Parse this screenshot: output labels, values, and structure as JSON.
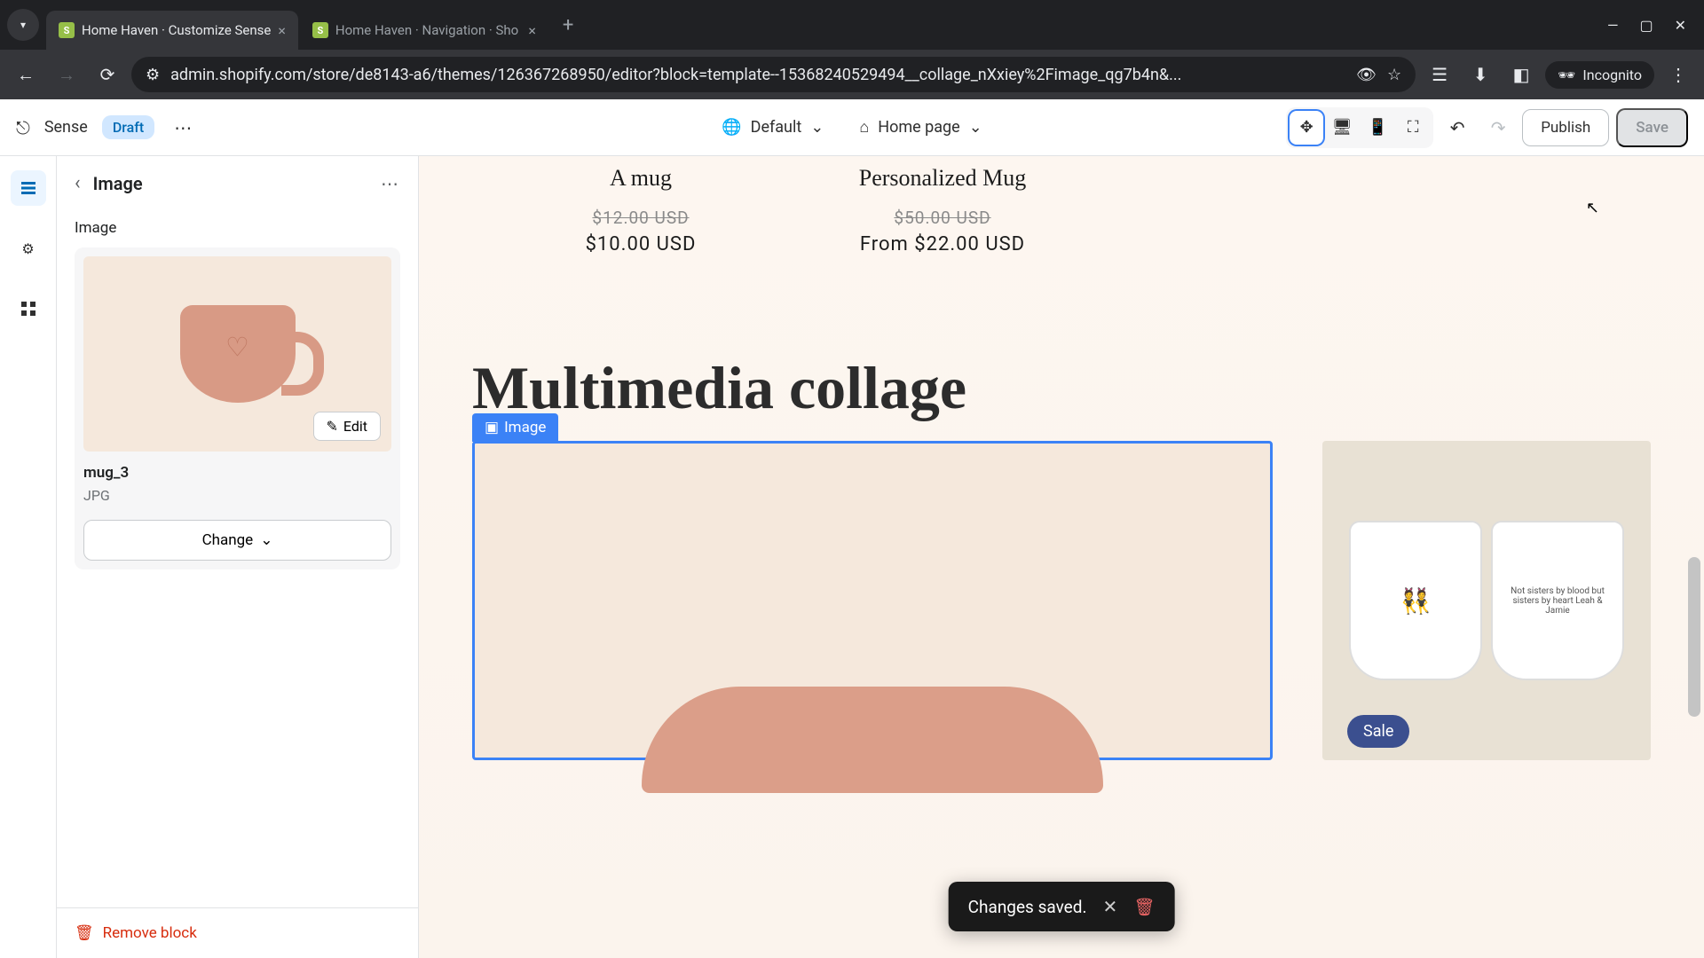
{
  "browser": {
    "tabs": [
      {
        "title": "Home Haven · Customize Sense"
      },
      {
        "title": "Home Haven · Navigation · Sho"
      }
    ],
    "url": "admin.shopify.com/store/de8143-a6/themes/126367268950/editor?block=template--15368240529494__collage_nXxiey%2Fimage_qg7b4n&...",
    "incognito": "Incognito"
  },
  "header": {
    "theme_name": "Sense",
    "draft_label": "Draft",
    "style_select": "Default",
    "page_select": "Home page",
    "publish": "Publish",
    "save": "Save"
  },
  "sidebar": {
    "title": "Image",
    "section_label": "Image",
    "filename": "mug_3",
    "filetype": "JPG",
    "edit_label": "Edit",
    "change_label": "Change",
    "remove_label": "Remove block"
  },
  "canvas": {
    "products": [
      {
        "title": "A mug",
        "old_price": "$12.00 USD",
        "new_price": "$10.00 USD"
      },
      {
        "title": "Personalized Mug",
        "old_price": "$50.00 USD",
        "new_price": "From $22.00 USD"
      }
    ],
    "collage_heading": "Multimedia collage",
    "image_tag": "Image",
    "sale_badge": "Sale",
    "side_mug_text": "Not sisters by blood but sisters by heart Leah & Jamie"
  },
  "toast": {
    "message": "Changes saved."
  }
}
